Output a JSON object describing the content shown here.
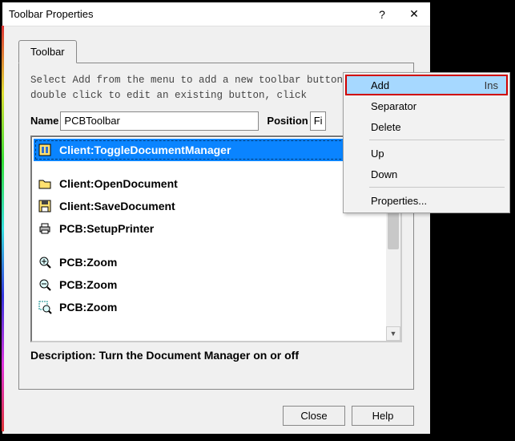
{
  "titlebar": {
    "title": "Toolbar Properties",
    "help_btn": "?",
    "close_btn": "✕"
  },
  "tab": {
    "label": "Toolbar"
  },
  "hint_text": "Select Add from the menu to add a new toolbar button,\ndouble click to edit an existing button, click",
  "fields": {
    "name_label": "Name",
    "name_value": "PCBToolbar",
    "position_label": "Position",
    "position_value": "Fi"
  },
  "list": {
    "items": [
      {
        "label": "Client:ToggleDocumentManager",
        "icon": "toggle-doc-icon",
        "selected": true
      },
      {
        "label": "Client:OpenDocument",
        "icon": "open-folder-icon",
        "separator_before": true
      },
      {
        "label": "Client:SaveDocument",
        "icon": "save-disk-icon"
      },
      {
        "label": "PCB:SetupPrinter",
        "icon": "printer-icon"
      },
      {
        "label": "PCB:Zoom",
        "icon": "zoom-in-icon",
        "separator_before": true
      },
      {
        "label": "PCB:Zoom",
        "icon": "zoom-out-icon"
      },
      {
        "label": "PCB:Zoom",
        "icon": "zoom-area-icon"
      }
    ]
  },
  "description": {
    "label": "Description:",
    "text": "Turn the Document Manager on or off"
  },
  "buttons": {
    "close": "Close",
    "help": "Help"
  },
  "context_menu": {
    "items": [
      {
        "label": "Add",
        "shortcut": "Ins",
        "highlighted": true
      },
      {
        "label": "Separator"
      },
      {
        "label": "Delete"
      },
      {
        "sep": true
      },
      {
        "label": "Up"
      },
      {
        "label": "Down"
      },
      {
        "sep": true
      },
      {
        "label": "Properties..."
      }
    ]
  }
}
